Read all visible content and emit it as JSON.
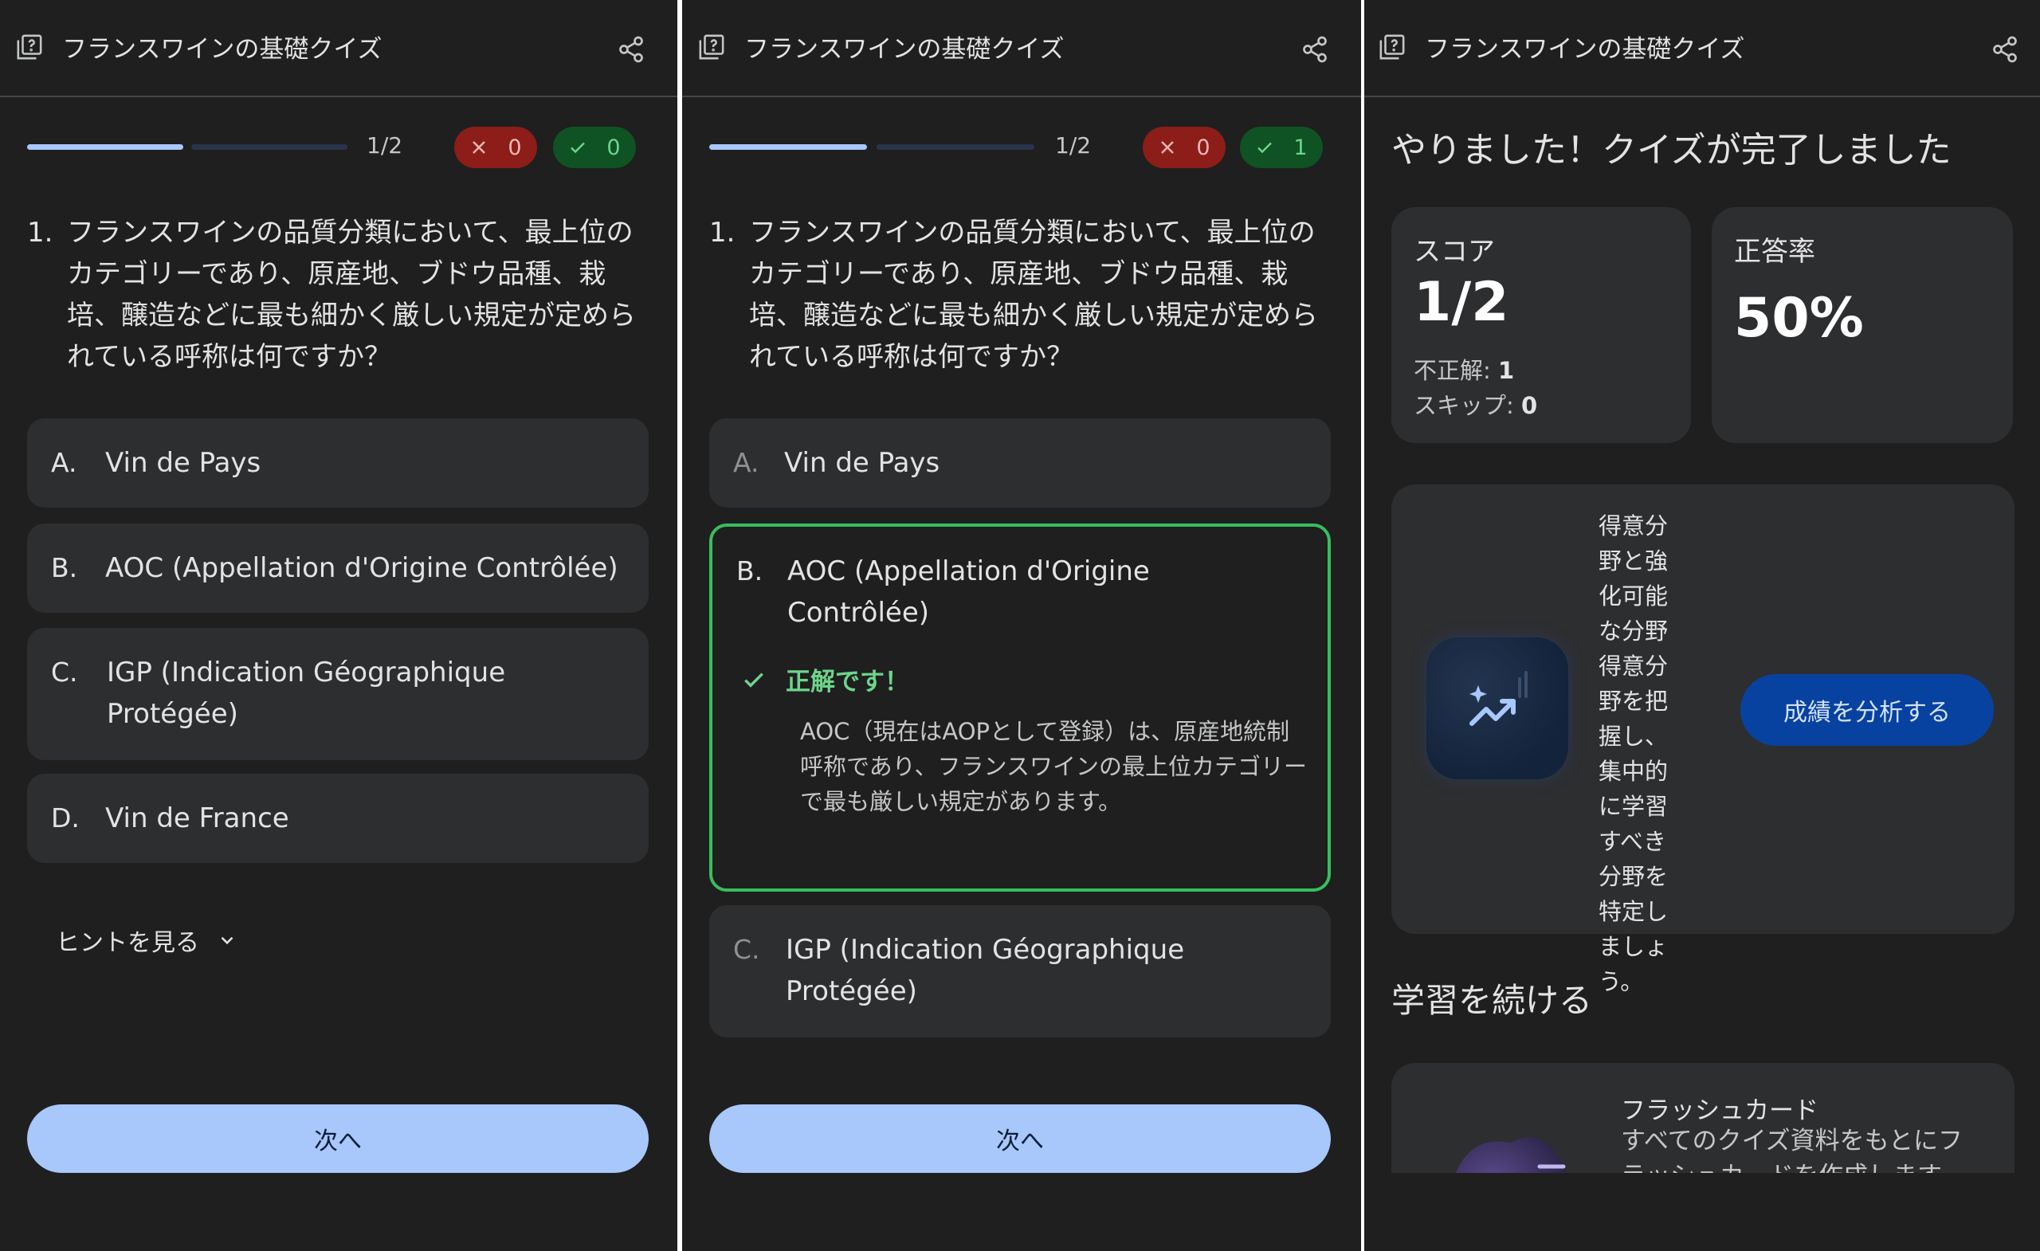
{
  "title": "フランスワインの基礎クイズ",
  "progress": {
    "label": "1/2",
    "current": 1,
    "total": 2
  },
  "question": {
    "number": "1.",
    "text": "フランスワインの品質分類において、最上位のカテゴリーであり、原産地、ブドウ品種、栽培、醸造などに最も細かく厳しい規定が定められている呼称は何ですか？"
  },
  "options": [
    {
      "letter": "A.",
      "text": "Vin de Pays"
    },
    {
      "letter": "B.",
      "text": "AOC (Appellation d'Origine Contrôlée)"
    },
    {
      "letter": "C.",
      "text": "IGP (Indication Géographique Protégée)"
    },
    {
      "letter": "D.",
      "text": "Vin de France"
    }
  ],
  "screen1": {
    "wrong": "0",
    "correct": "0"
  },
  "screen2": {
    "wrong": "0",
    "correct": "1"
  },
  "hint_label": "ヒントを見る",
  "next_label": "次へ",
  "feedback": {
    "title": "正解です！",
    "explanation": "AOC（現在はAOPとして登録）は、原産地統制呼称であり、フランスワインの最上位カテゴリーで最も厳しい規定があります。"
  },
  "results": {
    "title": "やりました！クイズが完了しました",
    "score_label": "スコア",
    "score": "1/2",
    "incorrect_label": "不正解:",
    "incorrect": "1",
    "skip_label": "スキップ:",
    "skip": "0",
    "rate_label": "正答率",
    "rate": "50%",
    "analysis_text": "得意分野と強化可能な分野 得意分野を把握し、集中的に学習すべき分野を特定しましょう。",
    "analysis_button": "成績を分析する",
    "continue_title": "学習を続ける",
    "flashcard_title": "フラッシュカード",
    "flashcard_desc": "すべてのクイズ資料をもとにフラッシュカードを作成します。重要"
  },
  "colors": {
    "background": "#1f1f1f",
    "card": "#2d2e30",
    "accent": "#a8c7fa",
    "correct": "#37be5f",
    "wrong_bg": "#8c1d18",
    "correct_bg": "#0f5223",
    "analyze_button": "#0842a0"
  },
  "icons": [
    "quiz-icon",
    "share-icon",
    "close-icon",
    "check-icon",
    "chevron-down-icon",
    "trending-up-icon",
    "flashcard-icon"
  ]
}
